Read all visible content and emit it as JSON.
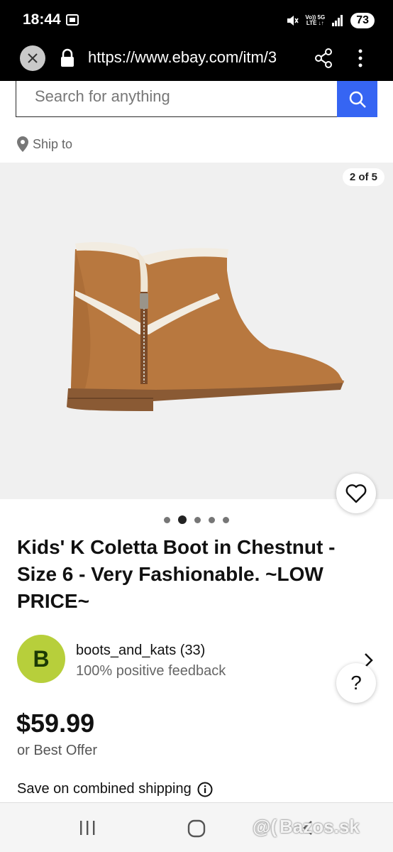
{
  "status_bar": {
    "time": "18:44",
    "network_top": "Vo)) 5G",
    "network_bottom": "LTE ↓↑",
    "battery": "73"
  },
  "browser": {
    "url": "https://www.ebay.com/itm/3"
  },
  "search": {
    "placeholder": "Search for anything"
  },
  "ship_to": {
    "label": "Ship to"
  },
  "gallery": {
    "counter": "2 of 5",
    "dot_count": 5,
    "active_index": 1
  },
  "listing": {
    "title": "Kids' K Coletta Boot in Chestnut - Size 6 - Very Fashionable. ~LOW PRICE~",
    "price": "$59.99",
    "best_offer": "or Best Offer",
    "shipping_note": "Save on combined shipping"
  },
  "seller": {
    "avatar_letter": "B",
    "name": "boots_and_kats (33)",
    "feedback": "100% positive feedback"
  },
  "help": {
    "label": "?"
  },
  "watermark": {
    "text": "Bazos.sk"
  },
  "colors": {
    "accent": "#3665f3",
    "avatar": "#b7cf3b",
    "gallery_bg": "#f0f0f0"
  }
}
